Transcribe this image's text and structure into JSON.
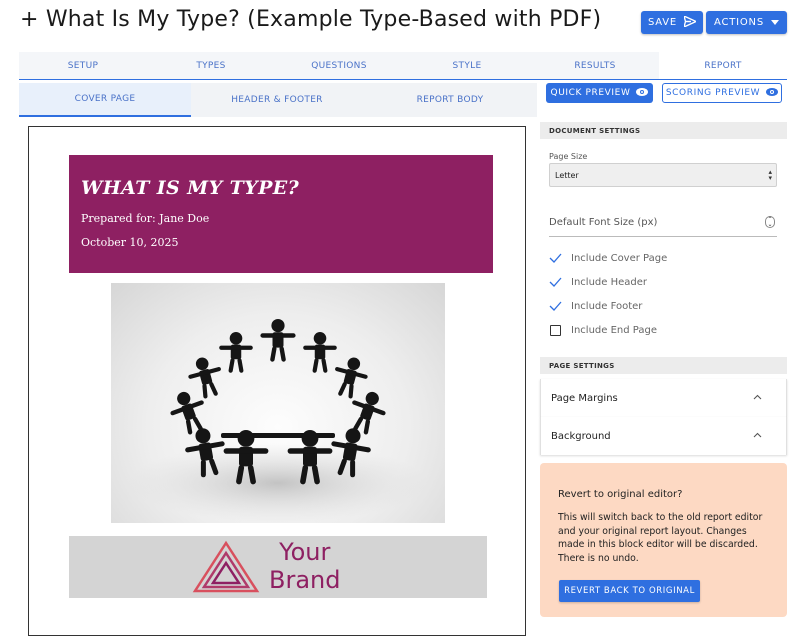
{
  "header": {
    "title": "+ What Is My Type? (Example Type-Based with PDF)",
    "save_label": "SAVE",
    "actions_label": "ACTIONS"
  },
  "tabs": [
    {
      "label": "SETUP"
    },
    {
      "label": "TYPES"
    },
    {
      "label": "QUESTIONS"
    },
    {
      "label": "STYLE"
    },
    {
      "label": "RESULTS"
    },
    {
      "label": "REPORT"
    }
  ],
  "active_tab": "REPORT",
  "subtabs": [
    {
      "label": "COVER PAGE"
    },
    {
      "label": "HEADER & FOOTER"
    },
    {
      "label": "REPORT BODY"
    }
  ],
  "active_subtab": "COVER PAGE",
  "preview": {
    "quick_label": "QUICK PREVIEW",
    "scoring_label": "SCORING PREVIEW"
  },
  "document": {
    "cover_title": "WHAT IS MY TYPE?",
    "prepared_for": "Prepared for: Jane Doe",
    "date": "October 10, 2025",
    "cover_color": "#8e2062",
    "brand_line1": "Your",
    "brand_line2": "Brand"
  },
  "settings": {
    "document_settings_heading": "DOCUMENT SETTINGS",
    "page_size_label": "Page Size",
    "page_size_value": "Letter",
    "font_size_placeholder": "Default Font Size (px)",
    "checkboxes": [
      {
        "label": "Include Cover Page",
        "checked": true
      },
      {
        "label": "Include Header",
        "checked": true
      },
      {
        "label": "Include Footer",
        "checked": true
      },
      {
        "label": "Include End Page",
        "checked": false
      }
    ],
    "page_settings_heading": "PAGE SETTINGS",
    "accordions": [
      {
        "label": "Page Margins"
      },
      {
        "label": "Background"
      }
    ]
  },
  "revert": {
    "title": "Revert to original editor?",
    "body": "This will switch back to the old report editor and your original report layout. Changes made in this block editor will be discarded. There is no undo.",
    "button_label": "REVERT BACK TO ORIGINAL",
    "background_color": "#fdd9c3"
  },
  "colors": {
    "accent": "#2f6fe0",
    "tab_text": "#4a72c8"
  }
}
